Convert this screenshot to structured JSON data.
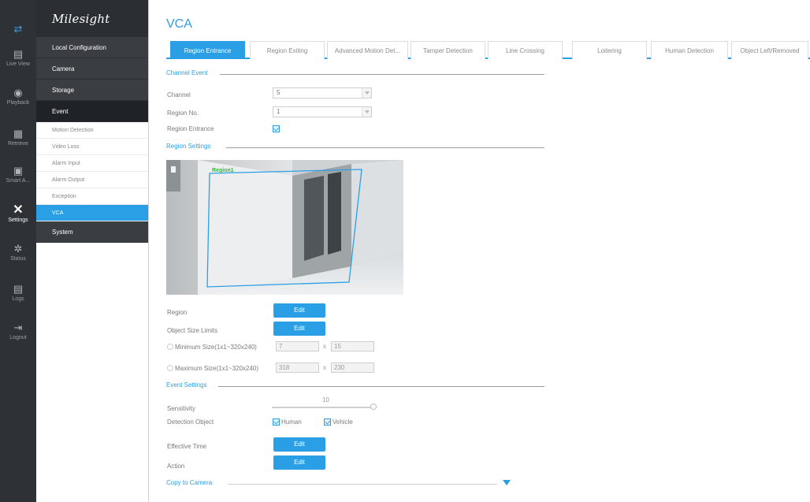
{
  "rail": [
    {
      "icon": "swap-arrows-icon",
      "label": ""
    },
    {
      "icon": "live-view-icon",
      "label": "Live View"
    },
    {
      "icon": "playback-icon",
      "label": "Playback"
    },
    {
      "icon": "retrieve-icon",
      "label": "Retrieve"
    },
    {
      "icon": "smart-analysis-icon",
      "label": "Smart A..."
    },
    {
      "icon": "settings-icon",
      "label": "Settings"
    },
    {
      "icon": "status-icon",
      "label": "Status"
    },
    {
      "icon": "logs-icon",
      "label": "Logs"
    },
    {
      "icon": "logout-icon",
      "label": "Logout"
    }
  ],
  "menu": {
    "brand": "Milesight",
    "local_configuration": "Local Configuration",
    "camera": "Camera",
    "storage": "Storage",
    "event": "Event",
    "event_items": [
      "Motion Detection",
      "Video Loss",
      "Alarm Input",
      "Alarm Output",
      "Exception",
      "VCA"
    ],
    "system": "System"
  },
  "page": {
    "title": "VCA",
    "tabs": [
      "Region Entrance",
      "Region Exiting",
      "Advanced Motion Det...",
      "Tamper Detection",
      "Line Crossing",
      "Loitering",
      "Human Detection",
      "Object Left/Removed"
    ]
  },
  "channel_event": {
    "section": "Channel Event",
    "channel_label": "Channel",
    "channel_value": "5",
    "region_no_label": "Region No.",
    "region_no_value": "1",
    "region_entrance_label": "Region Entrance"
  },
  "region_settings": {
    "section": "Region Settings",
    "region_overlay_label": "Region1",
    "region_label": "Region",
    "object_size_limits_label": "Object Size Limits",
    "edit": "Edit",
    "min_size_label": "Minimum Size(1x1~320x240)",
    "min_w": "7",
    "min_h": "15",
    "max_size_label": "Maximum Size(1x1~320x240)",
    "max_w": "318",
    "max_h": "230",
    "times": "x"
  },
  "event_settings": {
    "section": "Event Settings",
    "sensitivity_label": "Sensitivity",
    "sensitivity_value": "10",
    "detection_object_label": "Detection Object",
    "human": "Human",
    "vehicle": "Vehicle",
    "effective_time_label": "Effective Time",
    "action_label": "Action"
  },
  "copy": {
    "label": "Copy to Camera"
  },
  "colors": {
    "accent": "#2b9fe6",
    "rail_bg": "#2e3136",
    "menu_dark": "#3a3d42"
  }
}
